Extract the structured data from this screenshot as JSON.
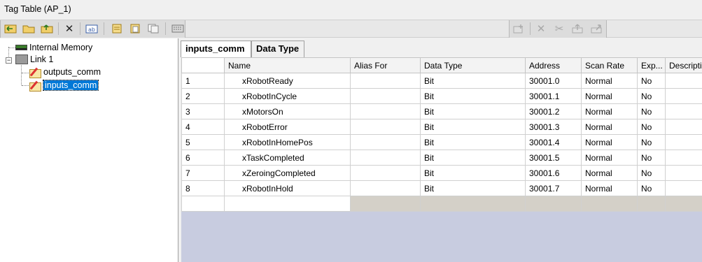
{
  "window": {
    "title": "Tag Table (AP_1)"
  },
  "toolbar": {
    "left_icons": [
      "import-tags-icon",
      "open-folder-icon",
      "export-tags-icon",
      "delete-icon",
      "rename-icon",
      "copy-folder-icon",
      "paste-icon",
      "duplicate-icon",
      "keyboard-icon"
    ],
    "right_icons": [
      "add-tag-icon",
      "cut-tag-icon",
      "scissors-icon",
      "move-up-icon",
      "export-icon"
    ],
    "delete_glyph": "✕"
  },
  "tree": {
    "internal_memory": "Internal Memory",
    "link": "Link 1",
    "expander": "−",
    "children": [
      "outputs_comm",
      "inputs_comm"
    ]
  },
  "tabs": [
    "inputs_comm",
    "Data Type"
  ],
  "grid": {
    "columns": [
      "Name",
      "Alias For",
      "Data Type",
      "Address",
      "Scan Rate",
      "Exp...",
      "Description"
    ],
    "rows": [
      {
        "num": "1",
        "name": "xRobotReady",
        "alias": "",
        "type": "Bit",
        "address": "30001.0",
        "scan": "Normal",
        "exp": "No",
        "desc": ""
      },
      {
        "num": "2",
        "name": "xRobotInCycle",
        "alias": "",
        "type": "Bit",
        "address": "30001.1",
        "scan": "Normal",
        "exp": "No",
        "desc": ""
      },
      {
        "num": "3",
        "name": "xMotorsOn",
        "alias": "",
        "type": "Bit",
        "address": "30001.2",
        "scan": "Normal",
        "exp": "No",
        "desc": ""
      },
      {
        "num": "4",
        "name": "xRobotError",
        "alias": "",
        "type": "Bit",
        "address": "30001.3",
        "scan": "Normal",
        "exp": "No",
        "desc": ""
      },
      {
        "num": "5",
        "name": "xRobotInHomePos",
        "alias": "",
        "type": "Bit",
        "address": "30001.4",
        "scan": "Normal",
        "exp": "No",
        "desc": ""
      },
      {
        "num": "6",
        "name": "xTaskCompleted",
        "alias": "",
        "type": "Bit",
        "address": "30001.5",
        "scan": "Normal",
        "exp": "No",
        "desc": ""
      },
      {
        "num": "7",
        "name": "xZeroingCompleted",
        "alias": "",
        "type": "Bit",
        "address": "30001.6",
        "scan": "Normal",
        "exp": "No",
        "desc": ""
      },
      {
        "num": "8",
        "name": "xRobotInHold",
        "alias": "",
        "type": "Bit",
        "address": "30001.7",
        "scan": "Normal",
        "exp": "No",
        "desc": ""
      }
    ]
  },
  "colors": {
    "selection": "#0078d7",
    "grid_empty": "#c8cce0",
    "new_row": "#d4d0c8"
  }
}
